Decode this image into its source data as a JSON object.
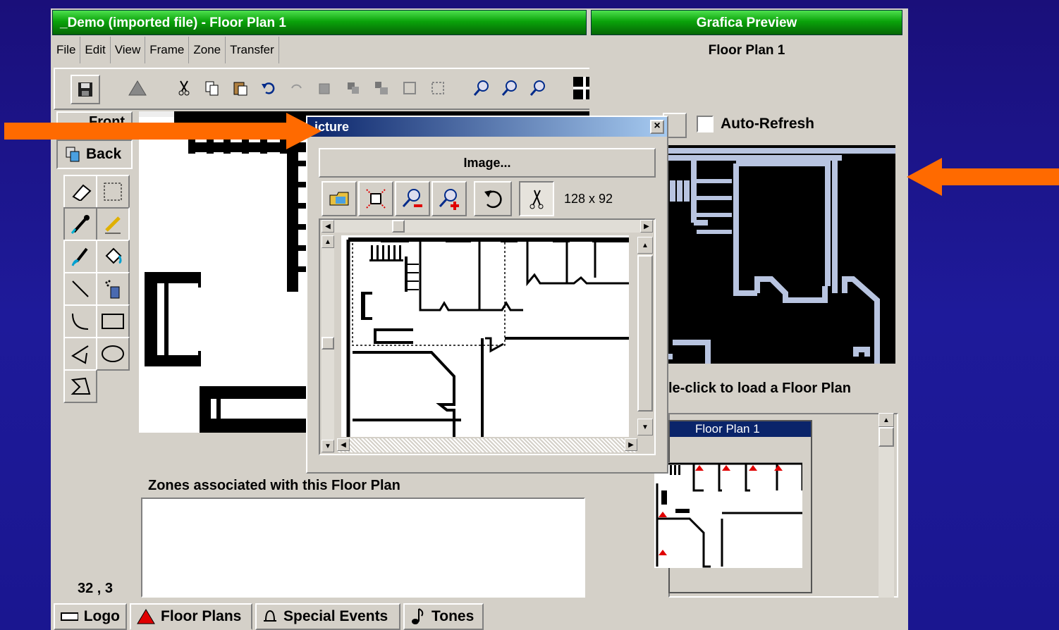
{
  "editor": {
    "title": "_Demo (imported file) - Floor Plan 1",
    "menu": [
      "File",
      "Edit",
      "View",
      "Frame",
      "Zone",
      "Transfer"
    ],
    "front_label": "Front",
    "back_label": "Back",
    "coords": "32 , 3",
    "zones_label": "Zones associated with this Floor Plan",
    "tabs": [
      "Logo",
      "Floor Plans",
      "Special Events",
      "Tones"
    ]
  },
  "preview": {
    "title": "Grafica Preview",
    "subtitle": "Floor Plan 1",
    "auto_refresh_label": "Auto-Refresh",
    "hint": "le-click to load a Floor Plan",
    "list_item": "Floor Plan 1"
  },
  "picture_dialog": {
    "title": "icture",
    "image_button": "Image...",
    "size": "128 x 92",
    "close": "×"
  },
  "colors": {
    "accent_arrow": "#ff6a00",
    "titlebar_green": "#0aa30a",
    "dialog_title_blue": "#0a246a",
    "list_highlight": "#0a246a",
    "preview_line": "#b8c4e0"
  }
}
